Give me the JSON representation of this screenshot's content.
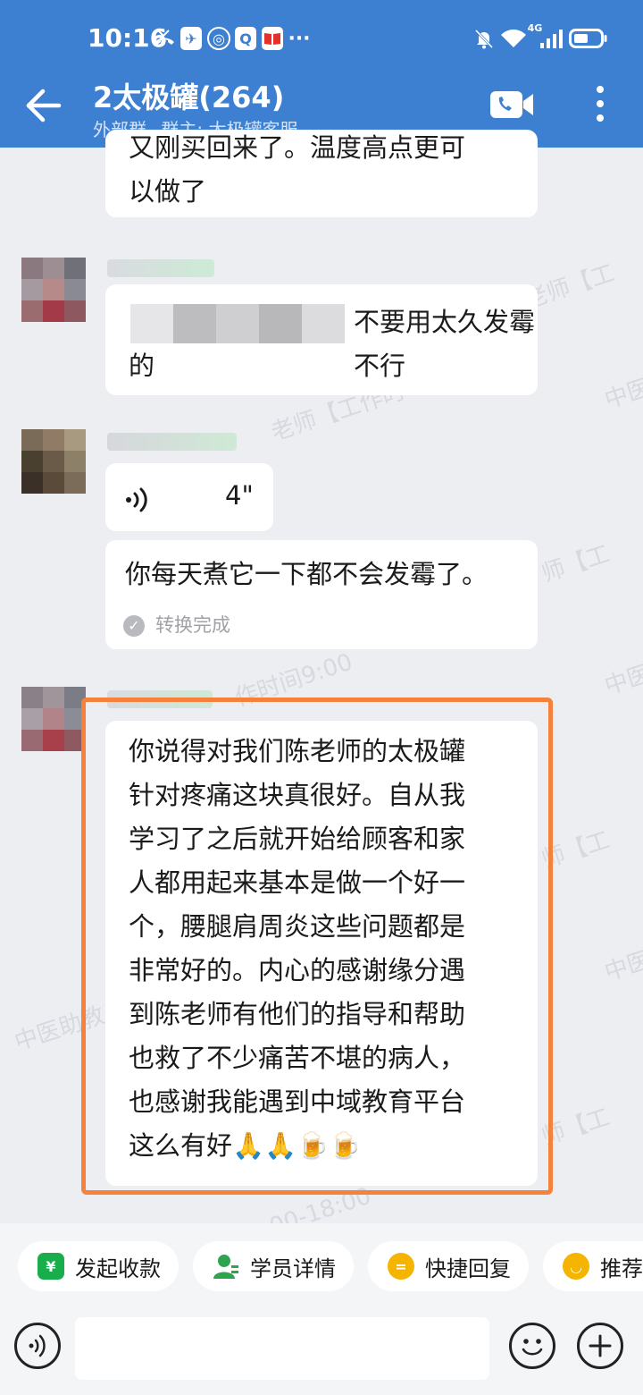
{
  "status_bar": {
    "time": "10:16",
    "left_icons": [
      "missed-call-icon",
      "app-icon",
      "browser-icon",
      "search-app-icon",
      "book-app-icon",
      "more-dots-icon"
    ],
    "network_label": "4G",
    "right_icons": [
      "mute-bell-icon",
      "wifi-icon",
      "signal-icon",
      "battery-icon"
    ]
  },
  "header": {
    "title": "2太极罐(264)",
    "group_type": "外部群",
    "owner_label": "群主: 太极罐客服",
    "back_icon": "back-arrow-icon",
    "video_icon": "video-call-icon",
    "menu_icon": "more-vertical-icon",
    "bg_color": "#3d7fd1"
  },
  "messages": [
    {
      "type": "text",
      "partial_line": "又刚买回来了。温度高点更可",
      "line2": "以做了"
    },
    {
      "type": "text",
      "line1_visible": "不要用太久发霉不行",
      "line2": "的",
      "sender_blurred": true
    },
    {
      "type": "voice",
      "duration": "4\"",
      "sender_blurred": true
    },
    {
      "type": "transcription",
      "text": "你每天煮它一下都不会发霉了。",
      "status": "转换完成"
    },
    {
      "type": "text",
      "sender_blurred": true,
      "highlighted": true,
      "lines": [
        "你说得对我们陈老师的太极罐",
        "针对疼痛这块真很好。自从我",
        "学习了之后就开始给顾客和家",
        "人都用起来基本是做一个好一",
        "个，腰腿肩周炎这些问题都是",
        "非常好的。内心的感谢缘分遇",
        "到陈老师有他们的指导和帮助",
        "也救了不少痛苦不堪的病人，",
        "也感谢我能遇到中域教育平台",
        "这么有好🙏🙏🍺🍺"
      ]
    }
  ],
  "watermark": {
    "texts": [
      "老师【工",
      "中医",
      "老师【工作时",
      "师【工",
      "中医",
      "作时间9:00",
      "师【工",
      "中医",
      "中医助教",
      "师【工",
      "00-18:00"
    ]
  },
  "quick_actions": [
    {
      "label": "发起收款",
      "icon": "payment-shield-icon",
      "color": "#1aad4b",
      "glyph": "¥"
    },
    {
      "label": "学员详情",
      "icon": "student-profile-icon",
      "color": "#2ea44f",
      "glyph": ""
    },
    {
      "label": "快捷回复",
      "icon": "quick-reply-icon",
      "color": "#f5b400",
      "glyph": "="
    },
    {
      "label": "推荐",
      "icon": "recommend-icon",
      "color": "#f5b400",
      "glyph": "◡"
    }
  ],
  "input_bar": {
    "placeholder": "",
    "voice_icon": "voice-input-icon",
    "emoji_icon": "emoji-icon",
    "plus_icon": "plus-icon"
  },
  "colors": {
    "highlight": "#f5813a",
    "background": "#edeef2"
  }
}
